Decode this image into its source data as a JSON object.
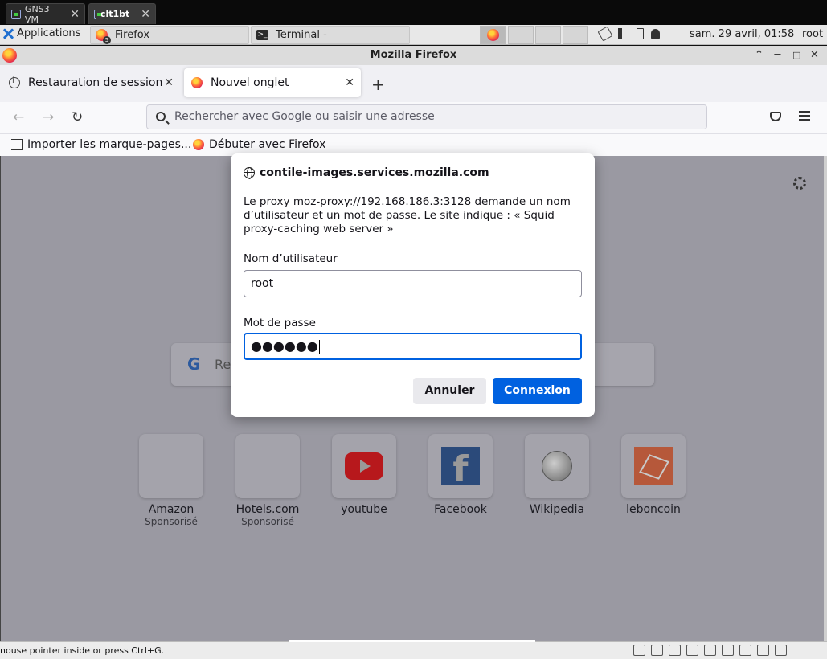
{
  "vm_tabs": [
    {
      "label": "GNS3 VM"
    },
    {
      "label": "clt1bt"
    }
  ],
  "panel": {
    "applications": "Applications",
    "tasks": [
      {
        "label": "Firefox",
        "badge": "5"
      },
      {
        "label": "Terminal -"
      }
    ],
    "clock": "sam. 29 avril, 01:58",
    "user": "root"
  },
  "firefox": {
    "window_title": "Mozilla Firefox",
    "tabs": [
      {
        "label": "Restauration de session"
      },
      {
        "label": "Nouvel onglet"
      }
    ],
    "url_placeholder": "Rechercher avec Google ou saisir une adresse",
    "bookmarks": [
      {
        "label": "Importer les marque-pages..."
      },
      {
        "label": "Débuter avec Firefox"
      }
    ]
  },
  "newtab": {
    "search_placeholder": "Rec",
    "tiles": [
      {
        "name": "Amazon",
        "sponsor": "Sponsorisé"
      },
      {
        "name": "Hotels.com",
        "sponsor": "Sponsorisé"
      },
      {
        "name": "youtube",
        "sponsor": ""
      },
      {
        "name": "Facebook",
        "sponsor": ""
      },
      {
        "name": "Wikipedia",
        "sponsor": ""
      },
      {
        "name": "leboncoin",
        "sponsor": ""
      }
    ]
  },
  "dialog": {
    "host": "contile-images.services.mozilla.com",
    "message": "Le proxy moz-proxy://192.168.186.3:3128 demande un nom d’utilisateur et un mot de passe. Le site indique : « Squid proxy-caching web server »",
    "username_label": "Nom d’utilisateur",
    "username_value": "root",
    "password_label": "Mot de passe",
    "password_value": "●●●●●●",
    "cancel_label": "Annuler",
    "connect_label": "Connexion"
  },
  "statusbar": {
    "message": "nouse pointer inside or press Ctrl+G."
  }
}
